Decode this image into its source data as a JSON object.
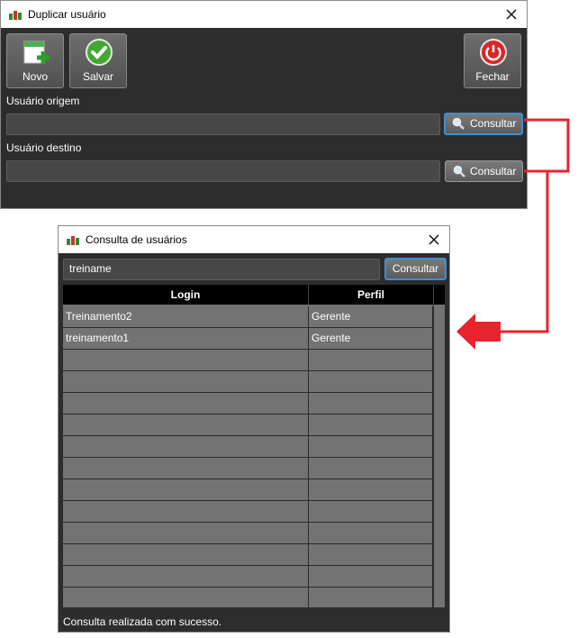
{
  "main_window": {
    "title": "Duplicar usuário",
    "toolbar": {
      "new_label": "Novo",
      "save_label": "Salvar",
      "close_label": "Fechar"
    },
    "origin": {
      "label": "Usuário origem",
      "value": "",
      "button": "Consultar"
    },
    "dest": {
      "label": "Usuário destino",
      "value": "",
      "button": "Consultar"
    }
  },
  "search_window": {
    "title": "Consulta de usuários",
    "search_value": "treiname",
    "search_button": "Consultar",
    "columns": [
      "Login",
      "Perfil"
    ],
    "rows": [
      {
        "login": "Treinamento2",
        "perfil": "Gerente"
      },
      {
        "login": "treinamento1",
        "perfil": "Gerente"
      }
    ],
    "status": "Consulta realizada com sucesso."
  },
  "colors": {
    "annotation": "#e8232e",
    "focus": "#3b8fd6",
    "window_bg": "#2d2d2d"
  }
}
